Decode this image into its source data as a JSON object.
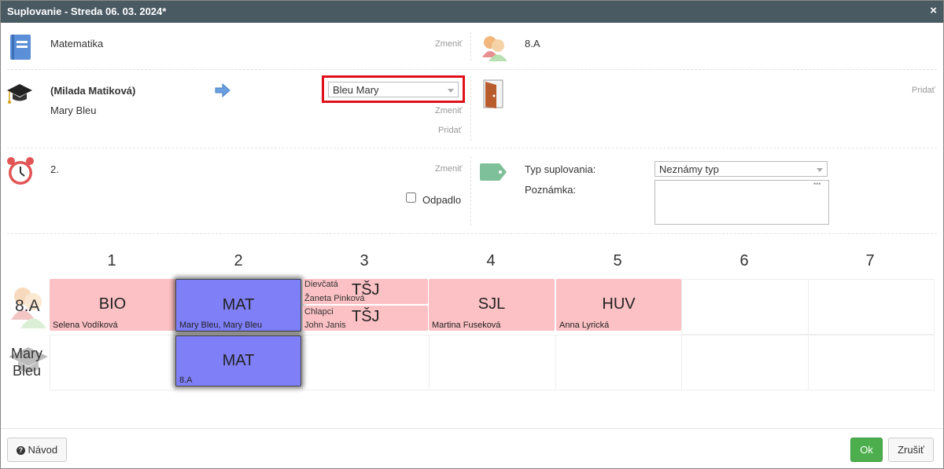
{
  "title": "Suplovanie - Streda 06. 03. 2024*",
  "close_label": "×",
  "subject": {
    "name": "Matematika",
    "change": "Zmeniť"
  },
  "class": {
    "name": "8.A"
  },
  "teacher": {
    "original": "(Milada Matiková)",
    "current": "Mary Bleu",
    "select_value": "Bleu Mary",
    "change": "Zmeniť",
    "add": "Pridať"
  },
  "room": {
    "add": "Pridať"
  },
  "period": {
    "value": "2.",
    "change": "Zmeniť",
    "cancelled_label": "Odpadlo"
  },
  "sub_type": {
    "type_label": "Typ suplovania:",
    "type_value": "Neznámy typ",
    "note_label": "Poznámka:",
    "note_icon": "•••"
  },
  "grid": {
    "columns": [
      "1",
      "2",
      "3",
      "4",
      "5",
      "6",
      "7"
    ],
    "row_labels": [
      "8.A",
      "Mary\nBleu"
    ],
    "row1": [
      {
        "subject": "BIO",
        "teacher": "Selena Vodíková"
      },
      {
        "subject": "MAT",
        "teacher": "Mary Bleu, Mary Bleu"
      },
      {
        "top_group": "Dievčatá",
        "top_subject": "TŠJ",
        "top_teacher": "Žaneta Pinková",
        "bottom_group": "Chlapci",
        "bottom_subject": "TŠJ",
        "bottom_teacher": "John Janis"
      },
      {
        "subject": "SJL",
        "teacher": "Martina Fuseková"
      },
      {
        "subject": "HUV",
        "teacher": "Anna Lyrická"
      }
    ],
    "row2": [
      {
        "subject": "MAT",
        "teacher": "8.A"
      }
    ]
  },
  "footer": {
    "help": "Návod",
    "ok": "Ok",
    "cancel": "Zrušiť"
  },
  "colors": {
    "title_bar": "#4a5a63",
    "lesson_pink": "#fcc1c4",
    "lesson_blue": "#7f7ff8",
    "ok_green": "#4cae4c",
    "highlight_red": "#e0101a"
  }
}
